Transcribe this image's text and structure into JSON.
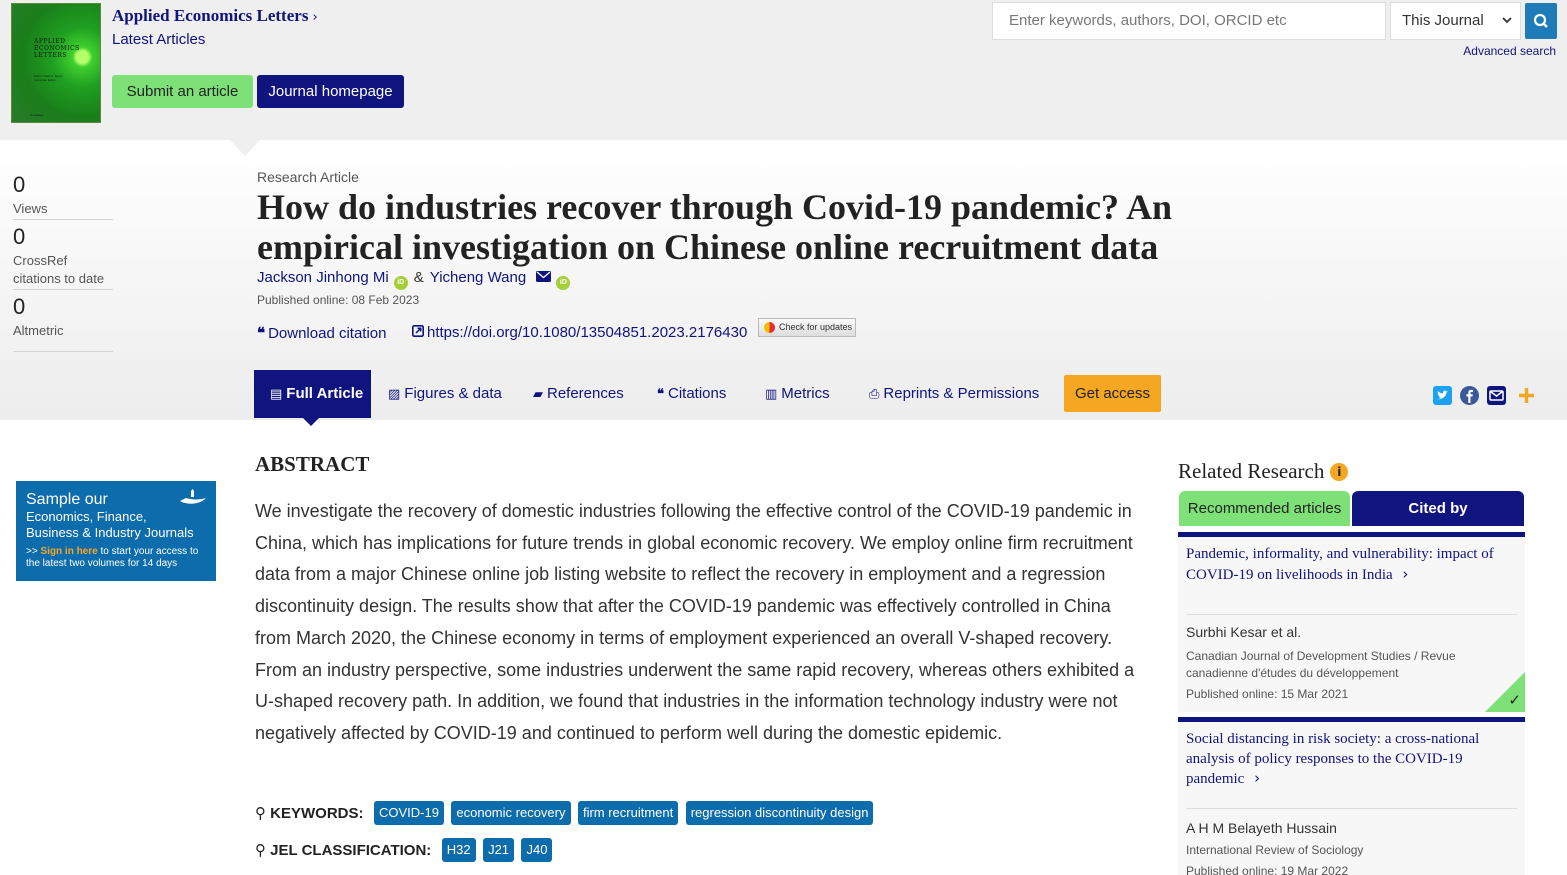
{
  "header": {
    "cover_title": "APPLIED\nECONOMICS\nLETTERS",
    "cover_editors": "Editor: Mark P. Taylor\nAssociate Editor: ...",
    "cover_publisher": "Routledge",
    "journal_title": "Applied Economics Letters",
    "latest_articles": "Latest Articles",
    "submit_label": "Submit an article",
    "homepage_label": "Journal homepage",
    "search_placeholder": "Enter keywords, authors, DOI, ORCID etc",
    "search_scope": "This Journal",
    "advanced_search": "Advanced search"
  },
  "metrics": [
    {
      "value": "0",
      "label": "Views"
    },
    {
      "value": "0",
      "label": "CrossRef citations to date"
    },
    {
      "value": "0",
      "label": "Altmetric"
    }
  ],
  "article": {
    "type": "Research Article",
    "title": "How do industries recover through Covid-19 pandemic? An empirical investigation on Chinese online recruitment data",
    "author1": "Jackson Jinhong Mi",
    "amp": "&",
    "author2": "Yicheng Wang",
    "published": "Published online: 08 Feb 2023",
    "download_citation": "Download citation",
    "doi": "https://doi.org/10.1080/13504851.2023.2176430",
    "check_updates": "Check for updates"
  },
  "tabs": {
    "full_article": "Full Article",
    "figures": "Figures & data",
    "references": "References",
    "citations": "Citations",
    "metrics": "Metrics",
    "reprints": "Reprints & Permissions",
    "get_access": "Get access"
  },
  "ad": {
    "line1": "Sample our",
    "line2": "Economics, Finance,",
    "line3": "Business & Industry Journals",
    "cta_prefix": ">> ",
    "cta_link": "Sign in here",
    "cta_rest": " to start your access to the latest two volumes for 14 days"
  },
  "abstract": {
    "heading": "ABSTRACT",
    "text": "We investigate the recovery of domestic industries following the effective control of the COVID-19 pandemic in China, which has implications for future trends in global economic recovery. We employ online firm recruitment data from a major Chinese online job listing website to reflect the recovery in employment and a regression discontinuity design. The results show that after the COVID-19 pandemic was effectively controlled in China from March 2020, the Chinese economy in terms of employment experienced an overall V-shaped recovery. From an industry perspective, some industries underwent the same rapid recovery, whereas others exhibited a U-shaped recovery path. In addition, we found that industries in the information technology industry were not negatively affected by COVID-19 and continued to perform well during the domestic epidemic."
  },
  "keywords": {
    "label": "KEYWORDS:",
    "items": [
      "COVID-19",
      "economic recovery",
      "firm recruitment",
      "regression discontinuity design"
    ]
  },
  "jel": {
    "label": "JEL CLASSIFICATION:",
    "items": [
      "H32",
      "J21",
      "J40"
    ]
  },
  "related": {
    "heading": "Related Research",
    "tab_recommended": "Recommended articles",
    "tab_cited": "Cited by",
    "articles": [
      {
        "title": "Pandemic, informality, and vulnerability: impact of COVID-19 on livelihoods in India",
        "authors": "Surbhi Kesar et al.",
        "journal": "Canadian Journal of Development Studies / Revue canadienne d'études du développement",
        "published": "Published online: 15 Mar 2021"
      },
      {
        "title": "Social distancing in risk society: a cross-national analysis of policy responses to the COVID-19 pandemic",
        "authors": "A H M Belayeth Hussain",
        "journal": "International Review of Sociology",
        "published": "Published online: 19 Mar 2022"
      }
    ]
  },
  "colors": {
    "brand_navy": "#10147e",
    "accent_green": "#7ee178",
    "link_blue": "#0d6cab",
    "access_orange": "#f5a623"
  }
}
